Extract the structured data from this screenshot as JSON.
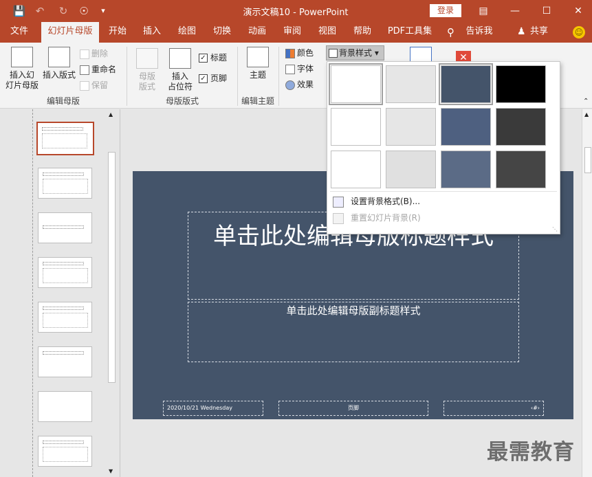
{
  "app": {
    "title": "演示文稿10  -  PowerPoint",
    "login": "登录"
  },
  "window": {
    "ribbon_display_icon": "ribbon-display-icon",
    "minimize": "—",
    "maximize": "☐",
    "close": "✕"
  },
  "quick_access": {
    "save": "save-icon",
    "undo": "undo-icon",
    "redo": "redo-icon",
    "touch": "touch-mode-icon",
    "customize": "customize-icon"
  },
  "tabs": [
    "文件",
    "幻灯片母版",
    "开始",
    "插入",
    "绘图",
    "切换",
    "动画",
    "审阅",
    "视图",
    "帮助",
    "PDF工具集",
    "告诉我",
    "共享"
  ],
  "ribbon": {
    "insert_master_line1": "插入幻",
    "insert_master_line2": "灯片母版",
    "insert_layout": "插入版式",
    "delete": "删除",
    "rename": "重命名",
    "preserve": "保留",
    "group_edit_master": "编辑母版",
    "master_layout_line1": "母版",
    "master_layout_line2": "版式",
    "insert_placeholder_line1": "插入",
    "insert_placeholder_line2": "占位符",
    "title_check": "标题",
    "footer_check": "页脚",
    "group_master_layout": "母版版式",
    "theme": "主题",
    "group_edit_theme": "编辑主题",
    "colors": "颜色",
    "fonts": "字体",
    "effects": "效果",
    "background_styles": "背景样式"
  },
  "dropdown": {
    "swatches": [
      {
        "color": "#ffffff",
        "selected": true
      },
      {
        "color": "#e6e6e6",
        "selected": false
      },
      {
        "color": "#44546a",
        "selected": true
      },
      {
        "color": "#000000",
        "selected": false
      },
      {
        "color": "#ffffff",
        "selected": false
      },
      {
        "color": "#e6e6e6",
        "selected": false
      },
      {
        "color": "#4e6080",
        "selected": false
      },
      {
        "color": "#3a3a3a",
        "selected": false
      },
      {
        "color": "#ffffff",
        "selected": false
      },
      {
        "color": "#e0e0e0",
        "selected": false
      },
      {
        "color": "#5b6b86",
        "selected": false
      },
      {
        "color": "#454545",
        "selected": false
      }
    ],
    "format_background": "设置背景格式(B)...",
    "reset_background": "重置幻灯片背景(R)"
  },
  "slide": {
    "title": "单击此处编辑母版标题样式",
    "subtitle": "单击此处编辑母版副标题样式",
    "date": "2020/10/21 Wednesday",
    "footer": "页脚",
    "number": "‹#›"
  },
  "watermark": "最需教育"
}
